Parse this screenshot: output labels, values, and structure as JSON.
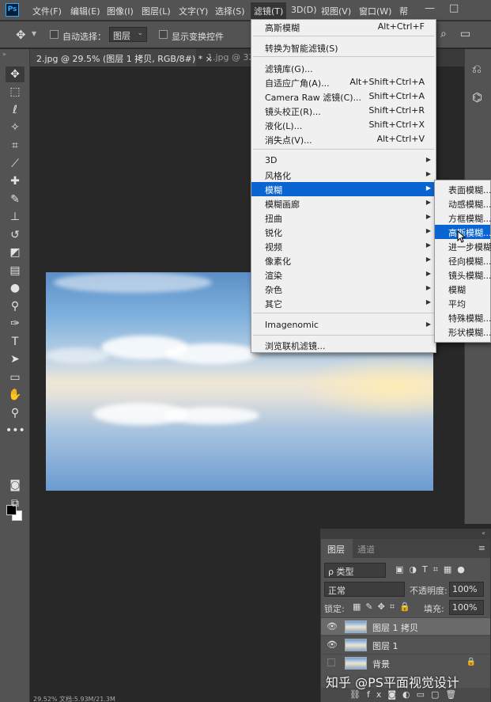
{
  "app": {
    "logo": "Ps"
  },
  "menubar": {
    "items": [
      {
        "label": "文件(F)"
      },
      {
        "label": "编辑(E)"
      },
      {
        "label": "图像(I)"
      },
      {
        "label": "图层(L)"
      },
      {
        "label": "文字(Y)"
      },
      {
        "label": "选择(S)"
      },
      {
        "label": "滤镜(T)"
      },
      {
        "label": "3D(D)"
      },
      {
        "label": "视图(V)"
      },
      {
        "label": "窗口(W)"
      },
      {
        "label": "帮"
      }
    ],
    "window_controls": [
      "—",
      "□"
    ]
  },
  "options": {
    "auto_select_label": "自动选择：",
    "auto_select_value": "图层",
    "show_transform_label": "显示变换控件"
  },
  "tabs": [
    {
      "label": "2.jpg @ 29.5% (图层 1 拷贝, RGB/8#) *  ×"
    },
    {
      "label": "1.jpg @ 32."
    }
  ],
  "filter_menu": {
    "items": [
      {
        "label": "高斯模糊",
        "shortcut": "Alt+Ctrl+F"
      },
      {
        "label": "转换为智能滤镜(S)",
        "shortcut": ""
      },
      {
        "label": "滤镜库(G)...",
        "shortcut": ""
      },
      {
        "label": "自适应广角(A)...",
        "shortcut": "Alt+Shift+Ctrl+A"
      },
      {
        "label": "Camera Raw 滤镜(C)...",
        "shortcut": "Shift+Ctrl+A"
      },
      {
        "label": "镜头校正(R)...",
        "shortcut": "Shift+Ctrl+R"
      },
      {
        "label": "液化(L)...",
        "shortcut": "Shift+Ctrl+X"
      },
      {
        "label": "消失点(V)...",
        "shortcut": "Alt+Ctrl+V"
      },
      {
        "label": "3D",
        "shortcut": ""
      },
      {
        "label": "风格化",
        "shortcut": ""
      },
      {
        "label": "模糊",
        "shortcut": ""
      },
      {
        "label": "模糊画廊",
        "shortcut": ""
      },
      {
        "label": "扭曲",
        "shortcut": ""
      },
      {
        "label": "锐化",
        "shortcut": ""
      },
      {
        "label": "视频",
        "shortcut": ""
      },
      {
        "label": "像素化",
        "shortcut": ""
      },
      {
        "label": "渲染",
        "shortcut": ""
      },
      {
        "label": "杂色",
        "shortcut": ""
      },
      {
        "label": "其它",
        "shortcut": ""
      },
      {
        "label": "Imagenomic",
        "shortcut": ""
      },
      {
        "label": "浏览联机滤镜...",
        "shortcut": ""
      }
    ]
  },
  "blur_submenu": {
    "items": [
      {
        "label": "表面模糊..."
      },
      {
        "label": "动感模糊..."
      },
      {
        "label": "方框模糊..."
      },
      {
        "label": "高斯模糊..."
      },
      {
        "label": "进一步模糊"
      },
      {
        "label": "径向模糊..."
      },
      {
        "label": "镜头模糊..."
      },
      {
        "label": "模糊"
      },
      {
        "label": "平均"
      },
      {
        "label": "特殊模糊..."
      },
      {
        "label": "形状模糊..."
      }
    ]
  },
  "layers_panel": {
    "tabs": [
      {
        "label": "图层"
      },
      {
        "label": "通道"
      }
    ],
    "filter_label": "ρ 类型",
    "blend_mode": "正常",
    "opacity_label": "不透明度:",
    "opacity_value": "100%",
    "lock_label": "锁定:",
    "fill_label": "填充:",
    "fill_value": "100%",
    "layers": [
      {
        "name": "图层 1 拷贝"
      },
      {
        "name": "图层 1"
      },
      {
        "name": "背景"
      }
    ]
  },
  "watermark": "知乎 @PS平面视觉设计",
  "status": "29.52%     文档:5.93M/21.3M"
}
